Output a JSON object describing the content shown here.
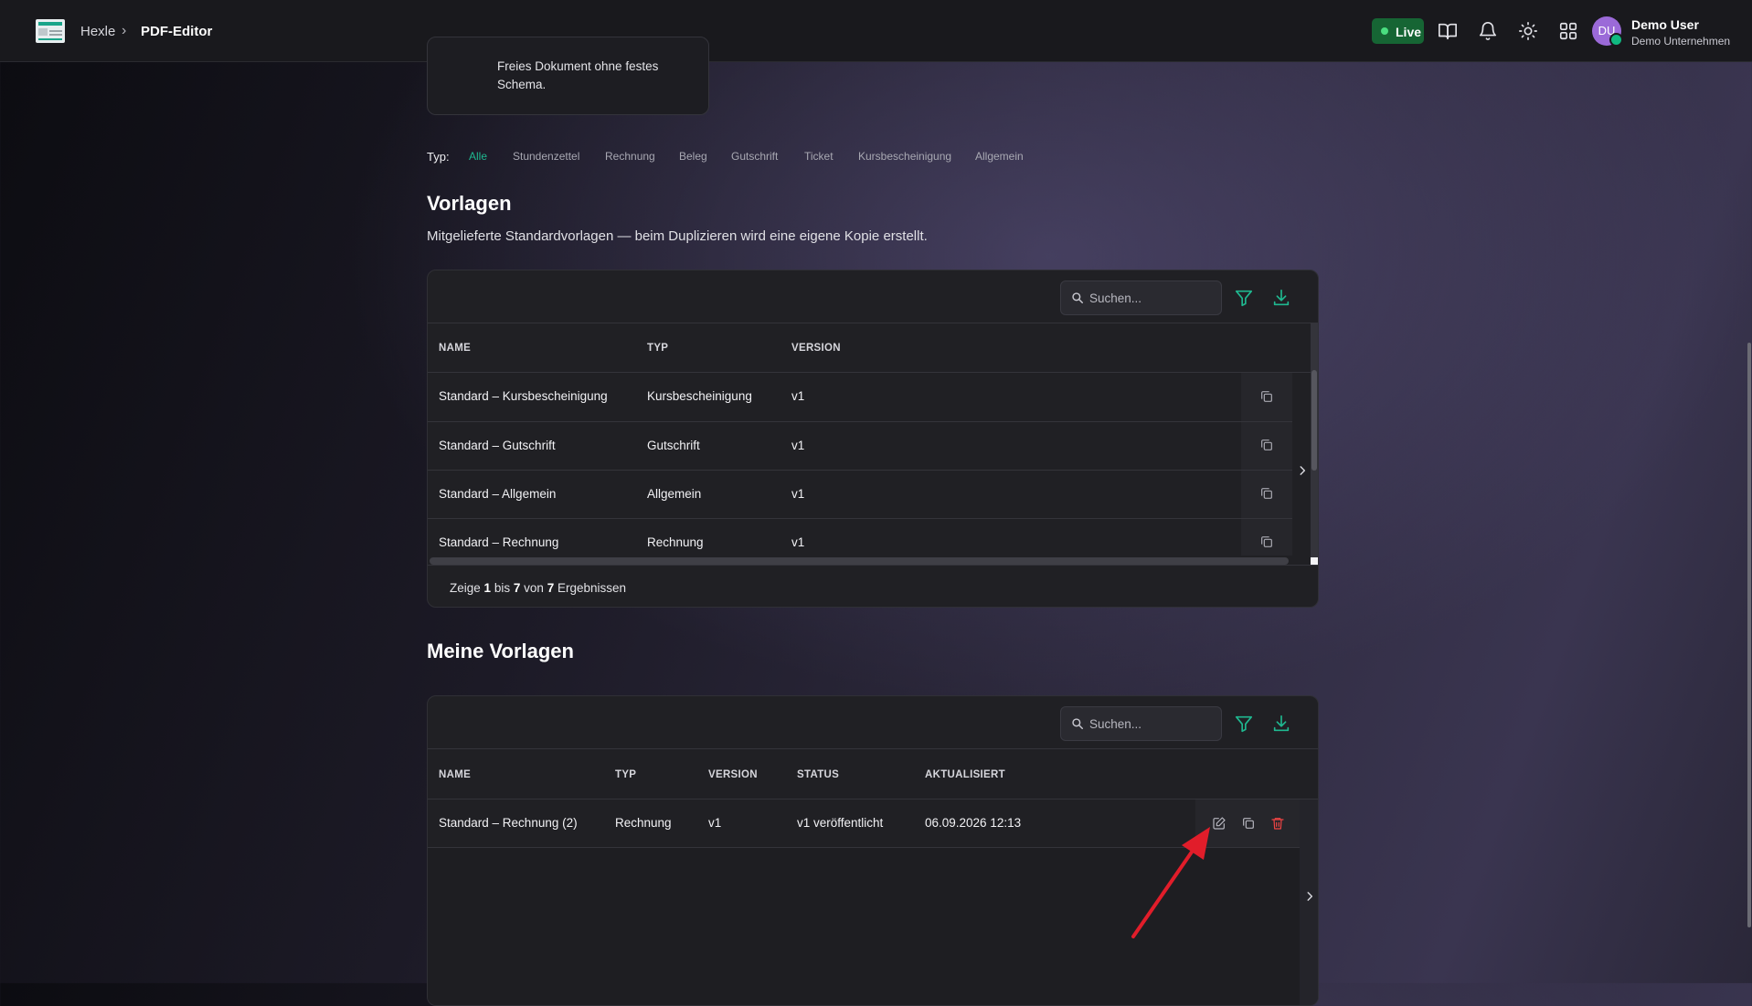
{
  "breadcrumb": {
    "root": "Hexle",
    "separator": "›",
    "current": "PDF-Editor"
  },
  "header": {
    "live_label": "Live",
    "user_initials": "DU",
    "user_name": "Demo User",
    "user_company": "Demo Unternehmen",
    "icons": [
      "docs-book-icon",
      "bell-icon",
      "sun-icon",
      "apps-grid-icon"
    ]
  },
  "top_card": {
    "description": "Freies Dokument ohne festes Schema."
  },
  "type_filter": {
    "label": "Typ:",
    "options": [
      "Alle",
      "Stundenzettel",
      "Rechnung",
      "Beleg",
      "Gutschrift",
      "Ticket",
      "Kursbescheinigung",
      "Allgemein"
    ],
    "active": "Alle"
  },
  "vorlagen": {
    "title": "Vorlagen",
    "subtitle": "Mitgelieferte Standardvorlagen — beim Duplizieren wird eine eigene Kopie erstellt.",
    "search_placeholder": "Suchen...",
    "columns": [
      "NAME",
      "TYP",
      "VERSION"
    ],
    "rows": [
      {
        "name": "Standard – Kursbescheinigung",
        "typ": "Kursbescheinigung",
        "version": "v1"
      },
      {
        "name": "Standard – Gutschrift",
        "typ": "Gutschrift",
        "version": "v1"
      },
      {
        "name": "Standard – Allgemein",
        "typ": "Allgemein",
        "version": "v1"
      },
      {
        "name": "Standard – Rechnung",
        "typ": "Rechnung",
        "version": "v1"
      }
    ],
    "pagination": {
      "prefix": "Zeige",
      "from": "1",
      "mid": "bis",
      "to": "7",
      "of": "von",
      "total": "7",
      "suffix": "Ergebnissen"
    }
  },
  "meine_vorlagen": {
    "title": "Meine Vorlagen",
    "search_placeholder": "Suchen...",
    "columns": [
      "NAME",
      "TYP",
      "VERSION",
      "STATUS",
      "AKTUALISIERT"
    ],
    "rows": [
      {
        "name": "Standard – Rechnung (2)",
        "typ": "Rechnung",
        "version": "v1",
        "status": "v1 veröffentlicht",
        "updated": "06.09.2026 12:13"
      }
    ]
  },
  "colors": {
    "accent": "#1fb890",
    "danger": "#ef4444",
    "live": "#166534",
    "annotation_arrow": "#e11d2a"
  }
}
